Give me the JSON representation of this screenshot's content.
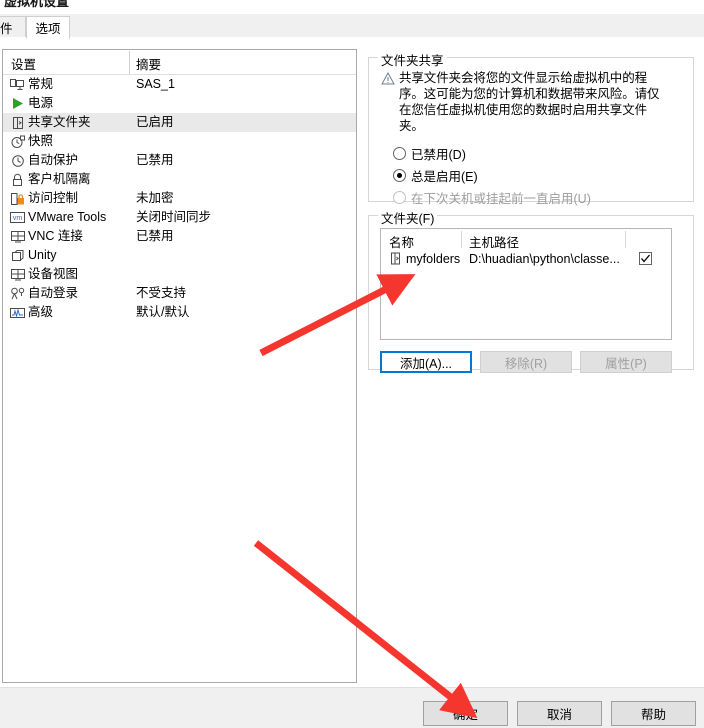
{
  "window": {
    "title": "虚拟机设置"
  },
  "tabs": [
    {
      "label": "硬件",
      "active": false
    },
    {
      "label": "选项",
      "active": true
    }
  ],
  "settings_list": {
    "headers": {
      "name": "设置",
      "summary": "摘要"
    },
    "rows": [
      {
        "icon": "monitor-icon",
        "name": "常规",
        "summary": "SAS_1",
        "selected": false
      },
      {
        "icon": "power-play-icon",
        "name": "电源",
        "summary": "",
        "selected": false
      },
      {
        "icon": "shared-folder-icon",
        "name": "共享文件夹",
        "summary": "已启用",
        "selected": true
      },
      {
        "icon": "snapshot-clock-icon",
        "name": "快照",
        "summary": "",
        "selected": false
      },
      {
        "icon": "autoprotect-icon",
        "name": "自动保护",
        "summary": "已禁用",
        "selected": false
      },
      {
        "icon": "lock-icon",
        "name": "客户机隔离",
        "summary": "",
        "selected": false
      },
      {
        "icon": "access-control-icon",
        "name": "访问控制",
        "summary": "未加密",
        "selected": false
      },
      {
        "icon": "vmware-tools-icon",
        "name": "VMware Tools",
        "summary": "关闭时间同步",
        "selected": false
      },
      {
        "icon": "vnc-icon",
        "name": "VNC 连接",
        "summary": "已禁用",
        "selected": false
      },
      {
        "icon": "unity-icon",
        "name": "Unity",
        "summary": "",
        "selected": false
      },
      {
        "icon": "device-view-icon",
        "name": "设备视图",
        "summary": "",
        "selected": false
      },
      {
        "icon": "auto-login-icon",
        "name": "自动登录",
        "summary": "不受支持",
        "selected": false
      },
      {
        "icon": "advanced-icon",
        "name": "高级",
        "summary": "默认/默认",
        "selected": false
      }
    ]
  },
  "sharing": {
    "legend": "文件夹共享",
    "warning_icon": "warning-triangle-icon",
    "warning_text": "共享文件夹会将您的文件显示给虚拟机中的程序。这可能为您的计算机和数据带来风险。请仅在您信任虚拟机使用您的数据时启用共享文件夹。",
    "options": [
      {
        "label": "已禁用(D)",
        "selected": false,
        "disabled": false
      },
      {
        "label": "总是启用(E)",
        "selected": true,
        "disabled": false
      },
      {
        "label": "在下次关机或挂起前一直启用(U)",
        "selected": false,
        "disabled": true
      }
    ]
  },
  "folders": {
    "legend": "文件夹(F)",
    "headers": {
      "name": "名称",
      "path": "主机路径",
      "enabled": ""
    },
    "rows": [
      {
        "icon": "folder-icon",
        "name": "myfolders",
        "path": "D:\\huadian\\python\\classe...",
        "enabled": true
      }
    ],
    "buttons": [
      {
        "label": "添加(A)...",
        "state": "focused"
      },
      {
        "label": "移除(R)",
        "state": "disabled"
      },
      {
        "label": "属性(P)",
        "state": "disabled"
      }
    ]
  },
  "dialog_buttons": [
    {
      "label": "确定"
    },
    {
      "label": "取消"
    },
    {
      "label": "帮助"
    }
  ],
  "annotations": {
    "arrow_color": "#f4362f",
    "arrows": [
      {
        "name": "arrow-to-folder-row",
        "points_to": "myfolders"
      },
      {
        "name": "arrow-to-ok-button",
        "points_to": "确定"
      }
    ]
  }
}
